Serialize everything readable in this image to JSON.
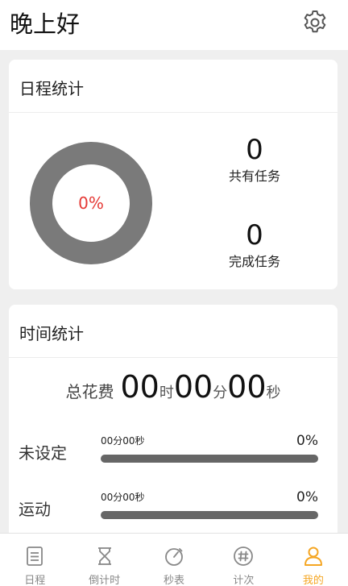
{
  "header": {
    "greeting": "晚上好",
    "settings_icon": "gear-icon"
  },
  "schedule": {
    "title": "日程统计",
    "progress_label": "0%",
    "progress": 0,
    "total_value": "0",
    "total_label": "共有任务",
    "done_value": "0",
    "done_label": "完成任务"
  },
  "time": {
    "title": "时间统计",
    "total_label": "总花费",
    "hours": "00",
    "hours_unit": "时",
    "minutes": "00",
    "minutes_unit": "分",
    "seconds": "00",
    "seconds_unit": "秒",
    "categories": [
      {
        "name": "未设定",
        "time": "00分00秒",
        "percent": "0%"
      },
      {
        "name": "运动",
        "time": "00分00秒",
        "percent": "0%"
      }
    ]
  },
  "tabbar": {
    "items": [
      {
        "label": "日程",
        "icon": "document-icon"
      },
      {
        "label": "倒计时",
        "icon": "hourglass-icon"
      },
      {
        "label": "秒表",
        "icon": "stopwatch-icon"
      },
      {
        "label": "计次",
        "icon": "hash-counter-icon"
      },
      {
        "label": "我的",
        "icon": "user-icon"
      }
    ],
    "active": "我的"
  },
  "colors": {
    "accent": "#f5a623",
    "percent_text": "#e53935",
    "ring": "#7a7a7a",
    "bar": "#666666"
  }
}
